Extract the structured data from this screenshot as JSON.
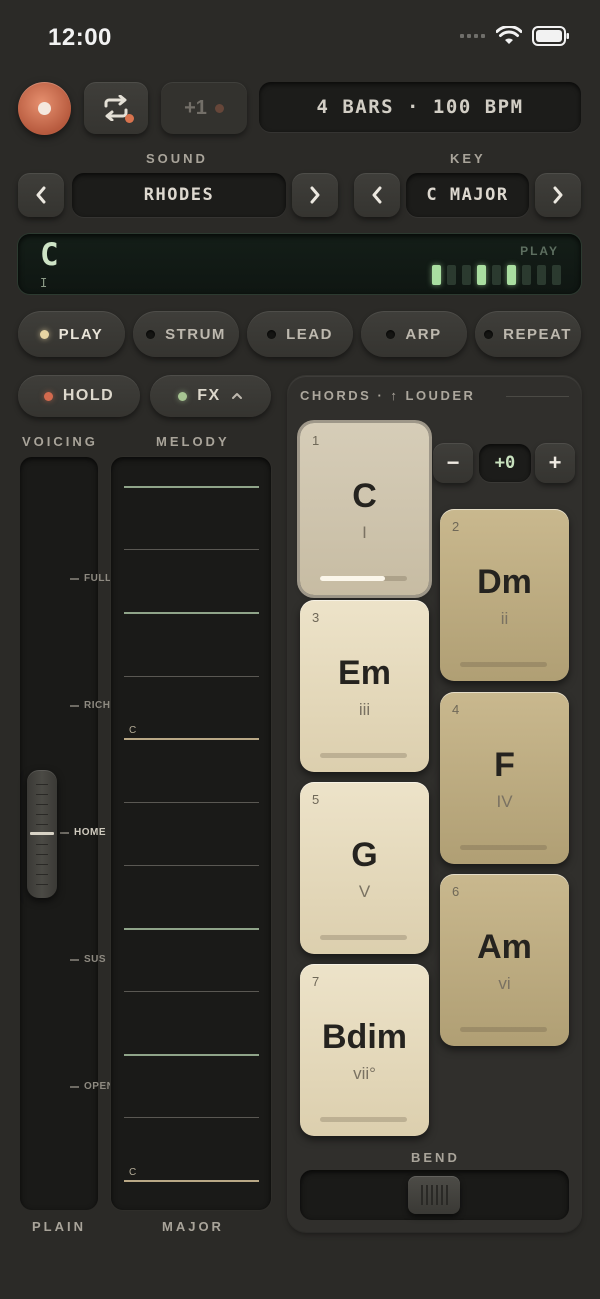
{
  "status": {
    "time": "12:00"
  },
  "transport": {
    "plus_label": "+1",
    "bars_bpm": "4 BARS · 100 BPM"
  },
  "sound": {
    "label": "SOUND",
    "value": "RHODES"
  },
  "key": {
    "label": "KEY",
    "value": "C MAJOR"
  },
  "chord_display": {
    "chord": "C",
    "cursor": "I",
    "mode_label": "PLAY",
    "meter": [
      1,
      0,
      0,
      1,
      0,
      1,
      0,
      0,
      0
    ]
  },
  "modes": [
    {
      "label": "PLAY",
      "active": true
    },
    {
      "label": "STRUM",
      "active": false
    },
    {
      "label": "LEAD",
      "active": false
    },
    {
      "label": "ARP",
      "active": false
    },
    {
      "label": "REPEAT",
      "active": false
    }
  ],
  "hold": {
    "label": "HOLD"
  },
  "fx": {
    "label": "FX"
  },
  "voicing": {
    "label": "VOICING",
    "bottom_label": "PLAIN",
    "marks": [
      "FULL",
      "RICH",
      "HOME",
      "SUS",
      "OPEN"
    ],
    "selected": "HOME"
  },
  "melody": {
    "label": "MELODY",
    "bottom_label": "MAJOR",
    "note_top": "C",
    "note_bottom": "C"
  },
  "chords": {
    "title": "CHORDS · ↑ LOUDER",
    "octave_value": "+0",
    "minus": "−",
    "plus": "+",
    "pads": [
      {
        "num": "1",
        "name": "C",
        "roman": "I",
        "level": 0.75
      },
      {
        "num": "2",
        "name": "Dm",
        "roman": "ii",
        "level": 0
      },
      {
        "num": "3",
        "name": "Em",
        "roman": "iii",
        "level": 0
      },
      {
        "num": "4",
        "name": "F",
        "roman": "IV",
        "level": 0
      },
      {
        "num": "5",
        "name": "G",
        "roman": "V",
        "level": 0
      },
      {
        "num": "6",
        "name": "Am",
        "roman": "vi",
        "level": 0
      },
      {
        "num": "7",
        "name": "Bdim",
        "roman": "vii°",
        "level": 0
      }
    ],
    "bend_label": "BEND"
  },
  "colors": {
    "background": "#2b2a27",
    "record": "#c46a4c",
    "display_green": "#cde3c5",
    "pad_light": "#e6dcc0",
    "pad_gold": "#bfae83"
  }
}
